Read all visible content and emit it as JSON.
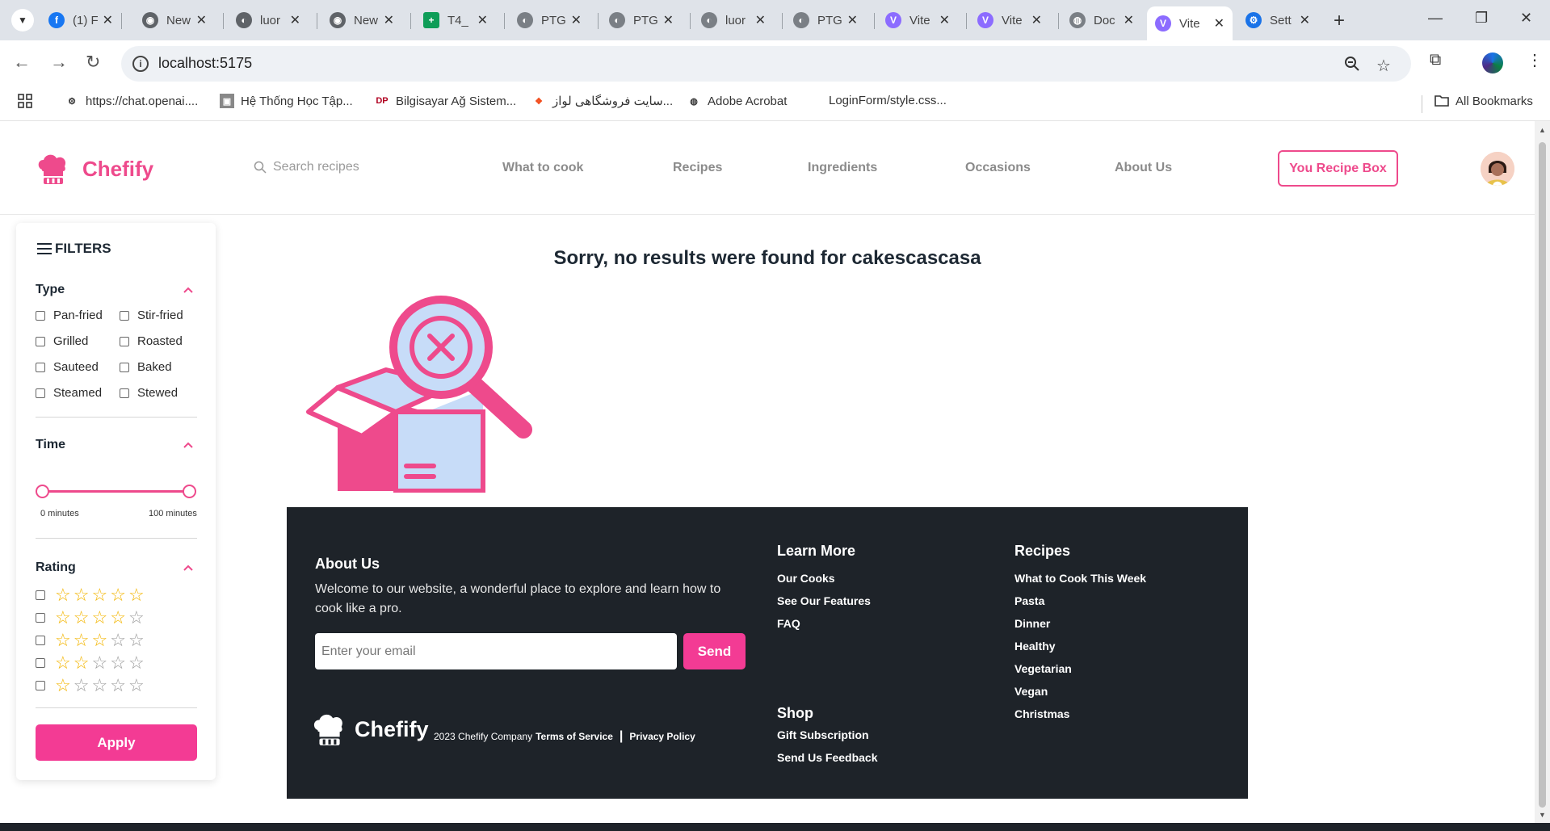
{
  "browser": {
    "tabs": [
      {
        "label": "(1) F",
        "icon": "facebook-icon",
        "color": "#1877f2"
      },
      {
        "label": "New",
        "icon": "chrome-icon",
        "color": "#5f6368"
      },
      {
        "label": "luor",
        "icon": "github-icon",
        "color": "#5f6368"
      },
      {
        "label": "New",
        "icon": "chrome-icon",
        "color": "#5f6368"
      },
      {
        "label": "T4_",
        "icon": "sheets-icon",
        "color": "#0f9d58"
      },
      {
        "label": "PTG",
        "icon": "github-icon",
        "color": "#5f6368"
      },
      {
        "label": "PTG",
        "icon": "github-icon",
        "color": "#5f6368"
      },
      {
        "label": "luor",
        "icon": "github-icon",
        "color": "#5f6368"
      },
      {
        "label": "PTG",
        "icon": "github-icon",
        "color": "#5f6368"
      },
      {
        "label": "Vite",
        "icon": "vite-icon",
        "color": "#8c6cff"
      },
      {
        "label": "Vite",
        "icon": "vite-icon",
        "color": "#8c6cff"
      },
      {
        "label": "Doc",
        "icon": "globe-icon",
        "color": "#5f6368"
      },
      {
        "label": "Vite",
        "icon": "vite-icon",
        "color": "#8c6cff",
        "active": true
      },
      {
        "label": "Sett",
        "icon": "gear-icon",
        "color": "#1a73e8"
      }
    ],
    "url": "localhost:5175",
    "bookmarks": [
      {
        "label": "https://chat.openai...."
      },
      {
        "label": "Hệ Thống Học Tập..."
      },
      {
        "label": "Bilgisayar Ağ Sistem..."
      },
      {
        "label": "سایت فروشگاهی لواز..."
      },
      {
        "label": "Adobe Acrobat"
      },
      {
        "label": "LoginForm/style.css..."
      }
    ],
    "all_bookmarks": "All Bookmarks"
  },
  "header": {
    "brand": "Chefify",
    "search_placeholder": "Search recipes",
    "nav": [
      "What to cook",
      "Recipes",
      "Ingredients",
      "Occasions",
      "About Us"
    ],
    "recipe_box": "You Recipe Box",
    "brand_color": "#ee4a8c"
  },
  "filters": {
    "title": "FILTERS",
    "type": {
      "heading": "Type",
      "options": [
        "Pan-fried",
        "Stir-fried",
        "Grilled",
        "Roasted",
        "Sauteed",
        "Baked",
        "Steamed",
        "Stewed"
      ]
    },
    "time": {
      "heading": "Time",
      "min_label": "0 minutes",
      "max_label": "100 minutes",
      "range": [
        0,
        100
      ]
    },
    "rating": {
      "heading": "Rating",
      "rows": [
        5,
        4,
        3,
        2,
        1
      ]
    },
    "apply": "Apply"
  },
  "main": {
    "message": "Sorry, no results were found for cakescascasa"
  },
  "footer": {
    "about": {
      "heading": "About Us",
      "text": "Welcome to our website, a wonderful place to explore and learn how to cook like a pro.",
      "email_placeholder": "Enter your email",
      "send": "Send"
    },
    "learn_more": {
      "heading": "Learn More",
      "links": [
        "Our Cooks",
        "See Our Features",
        "FAQ"
      ]
    },
    "shop": {
      "heading": "Shop",
      "links": [
        "Gift Subscription",
        "Send Us Feedback"
      ]
    },
    "recipes": {
      "heading": "Recipes",
      "links": [
        "What to Cook This Week",
        "Pasta",
        "Dinner",
        "Healthy",
        "Vegetarian",
        "Vegan",
        "Christmas"
      ]
    },
    "brand": "Chefify",
    "copyright": "2023 Chefify Company",
    "terms": "Terms of Service",
    "privacy": "Privacy Policy"
  }
}
